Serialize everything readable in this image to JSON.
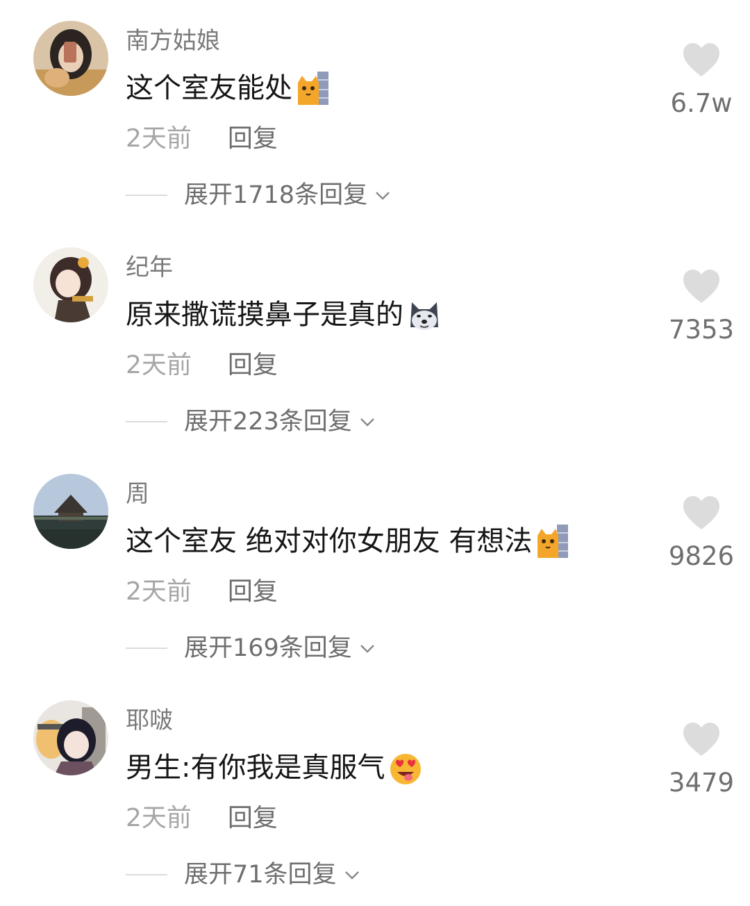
{
  "comments": [
    {
      "username": "南方姑娘",
      "text": "这个室友能处",
      "emoji": "cat-peeking-emoji",
      "time": "2天前",
      "reply": "回复",
      "expand": "展开1718条回复",
      "likes": "6.7w"
    },
    {
      "username": "纪年",
      "text": "原来撒谎摸鼻子是真的",
      "emoji": "husky-dog-emoji",
      "time": "2天前",
      "reply": "回复",
      "expand": "展开223条回复",
      "likes": "7353"
    },
    {
      "username": "周",
      "text": "这个室友 绝对对你女朋友 有想法",
      "emoji": "cat-peeking-emoji",
      "time": "2天前",
      "reply": "回复",
      "expand": "展开169条回复",
      "likes": "9826"
    },
    {
      "username": "耶啵",
      "text": "男生:有你我是真服气",
      "emoji": "heart-eyes-emoji",
      "time": "2天前",
      "reply": "回复",
      "expand": "展开71条回复",
      "likes": "3479"
    }
  ],
  "colors": {
    "text": "#161616",
    "secondary": "#7a7a7a",
    "muted": "#a6a6a6",
    "heart": "#dcdcdc"
  }
}
